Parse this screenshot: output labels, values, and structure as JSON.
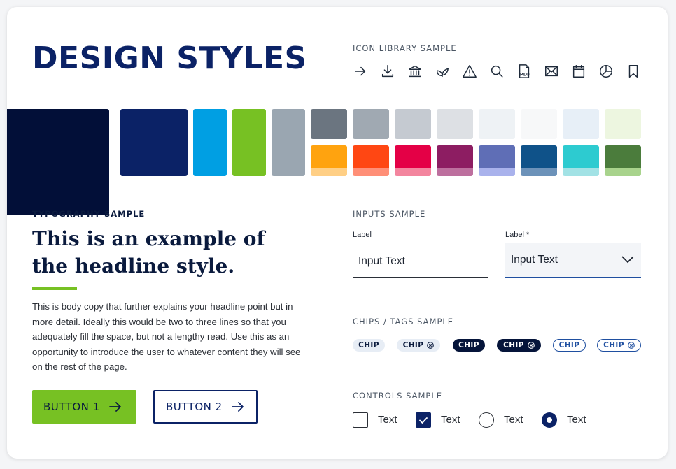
{
  "header": {
    "title": "DESIGN STYLES"
  },
  "icon_library": {
    "heading": "ICON LIBRARY SAMPLE",
    "icons": [
      "arrow-right-icon",
      "download-icon",
      "bank-icon",
      "leaf-icon",
      "warning-icon",
      "search-icon",
      "pdf-icon",
      "mail-icon",
      "calendar-icon",
      "pie-chart-icon",
      "bookmark-icon"
    ],
    "pdf_text": "PDF"
  },
  "palette": {
    "primary": [
      "#020f38",
      "#0b2266",
      "#009fe3",
      "#77c123",
      "#9aa6b1"
    ],
    "grays": [
      "#6b7580",
      "#a0a9b2",
      "#c5cad1",
      "#dde0e4",
      "#eef2f5",
      "#f7f8f9",
      "#e7eff7",
      "#edf6e0"
    ],
    "accents": [
      {
        "main": "#ffa30f",
        "tint": "#ffcf85"
      },
      {
        "main": "#ff4713",
        "tint": "#ff8f77"
      },
      {
        "main": "#e40046",
        "tint": "#f3859e"
      },
      {
        "main": "#8d1d62",
        "tint": "#bd6f9e"
      },
      {
        "main": "#5f6eb6",
        "tint": "#a9b2ec"
      },
      {
        "main": "#0f5289",
        "tint": "#6c92b9"
      },
      {
        "main": "#2dcbd0",
        "tint": "#a2e2e5"
      },
      {
        "main": "#4b7c3c",
        "tint": "#a8d38c"
      }
    ]
  },
  "typography": {
    "heading": "TYPOGRAPHY SAMPLE",
    "headline": "This is an example of the headline style.",
    "body": "This is body copy that further explains your headline point but in more detail. Ideally this would be two to three lines so that you adequately fill the space, but not a lengthy read. Use this as an opportunity to introduce the user to whatever content they will see on the rest of the page.",
    "button1": "BUTTON 1",
    "button2": "BUTTON 2"
  },
  "inputs": {
    "heading": "INPUTS SAMPLE",
    "field1": {
      "label": "Label",
      "value": "Input Text"
    },
    "field2": {
      "label": "Label *",
      "value": "Input Text"
    }
  },
  "chips": {
    "heading": "CHIPS / TAGS SAMPLE",
    "items": [
      {
        "label": "CHIP",
        "style": "light",
        "removable": false
      },
      {
        "label": "CHIP",
        "style": "light",
        "removable": true
      },
      {
        "label": "CHIP",
        "style": "dark",
        "removable": false
      },
      {
        "label": "CHIP",
        "style": "dark",
        "removable": true
      },
      {
        "label": "CHIP",
        "style": "outline",
        "removable": false
      },
      {
        "label": "CHIP",
        "style": "outline",
        "removable": true
      }
    ]
  },
  "controls": {
    "heading": "CONTROLS SAMPLE",
    "items": [
      {
        "type": "checkbox",
        "checked": false,
        "label": "Text"
      },
      {
        "type": "checkbox",
        "checked": true,
        "label": "Text"
      },
      {
        "type": "radio",
        "checked": false,
        "label": "Text"
      },
      {
        "type": "radio",
        "checked": true,
        "label": "Text"
      }
    ]
  }
}
